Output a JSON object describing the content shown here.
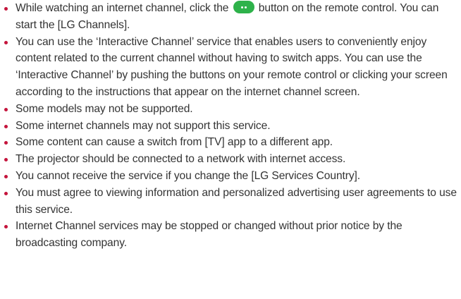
{
  "items": [
    {
      "before": "While watching an internet channel, click the ",
      "icon": "remote-green-button-icon",
      "after": " button on the remote control. You can start the [LG Channels]."
    },
    {
      "text": "You can use the ‘Interactive Channel’ service that enables users to conveniently enjoy content related to the current channel without having to switch apps. You can use the ‘Interactive Channel’ by pushing the buttons on your remote control or clicking your screen according to the instructions that appear on the internet channel screen."
    },
    {
      "text": "Some models may not be supported."
    },
    {
      "text": "Some internet channels may not support this service."
    },
    {
      "text": "Some content can cause a switch from [TV] app to a different app."
    },
    {
      "text": "The projector should be connected to a network with internet access."
    },
    {
      "text": "You cannot receive the service if you change the [LG Services Country]."
    },
    {
      "text": "You must agree to viewing information and personalized advertising user agreements to use this service."
    },
    {
      "text": "Internet Channel services may be stopped or changed without prior notice by the broadcasting company."
    }
  ],
  "colors": {
    "bullet": "#c4143c",
    "remote_button": "#2eb24a",
    "text": "#333333"
  }
}
